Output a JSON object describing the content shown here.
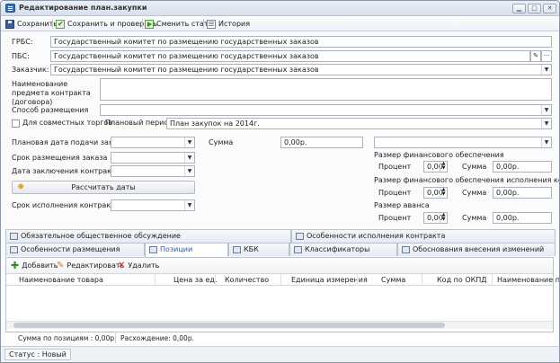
{
  "window": {
    "title": "Редактирование план.закупки"
  },
  "toolbar": {
    "save": "Сохранить",
    "save_check": "Сохранить и проверить",
    "change_status": "Сменить статус",
    "history": "История"
  },
  "form": {
    "grbs_label": "ГРБС:",
    "grbs_value": "Государственный комитет по размещению государственных заказов",
    "pbs_label": "ПБС:",
    "pbs_value": "Государственный комитет по размещению государственных заказов",
    "customer_label": "Заказчик:",
    "customer_value": "Государственный комитет по размещению государственных заказов",
    "subject_label": "Наименование предмета контракта (договора)",
    "subject_value": "",
    "method_label": "Способ размещения",
    "method_value": "",
    "joint_label": "Для совместных торгов",
    "plan_period_label": "Плановый период",
    "plan_period_value": "План закупок на 2014г.",
    "submit_date_label": "Плановая  дата подачи заявки",
    "order_term_label": "Срок размещения заказа",
    "contract_date_label": "Дата заключения контракта",
    "calc_button": "Рассчитать даты",
    "exec_term_label": "Срок исполнения контракта",
    "sum_label": "Сумма",
    "sum_value": "0,00р.",
    "fin_label": "Размер финансового обеспечения",
    "fin_exec_label": "Размер финансового обеспечения исполнения контракта",
    "advance_label": "Размер аванса",
    "percent_label": "Процент",
    "percent_value": "0,00",
    "sum2_label": "Сумма",
    "sum2_value": "0,00р."
  },
  "tabs": {
    "row1": [
      "Обязательное общественное обсуждение",
      "Особенности исполнения  контракта"
    ],
    "row2": [
      "Особенности размещения",
      "Позиции",
      "КБК",
      "Классификаторы",
      "Обоснования внесения изменений"
    ]
  },
  "grid": {
    "add": "Добавить",
    "edit": "Редактировать",
    "delete": "Удалить",
    "columns": [
      "Наименование товара",
      "Цена за ед.",
      "Количество",
      "Единица измерения",
      "Сумма",
      "Код по ОКПД",
      "Наименование п"
    ]
  },
  "summary": {
    "positions_sum": "Сумма по позициям : 0,00р.",
    "difference": "Расхождение: 0,00р."
  },
  "status": {
    "text": "Статус : Новый"
  }
}
